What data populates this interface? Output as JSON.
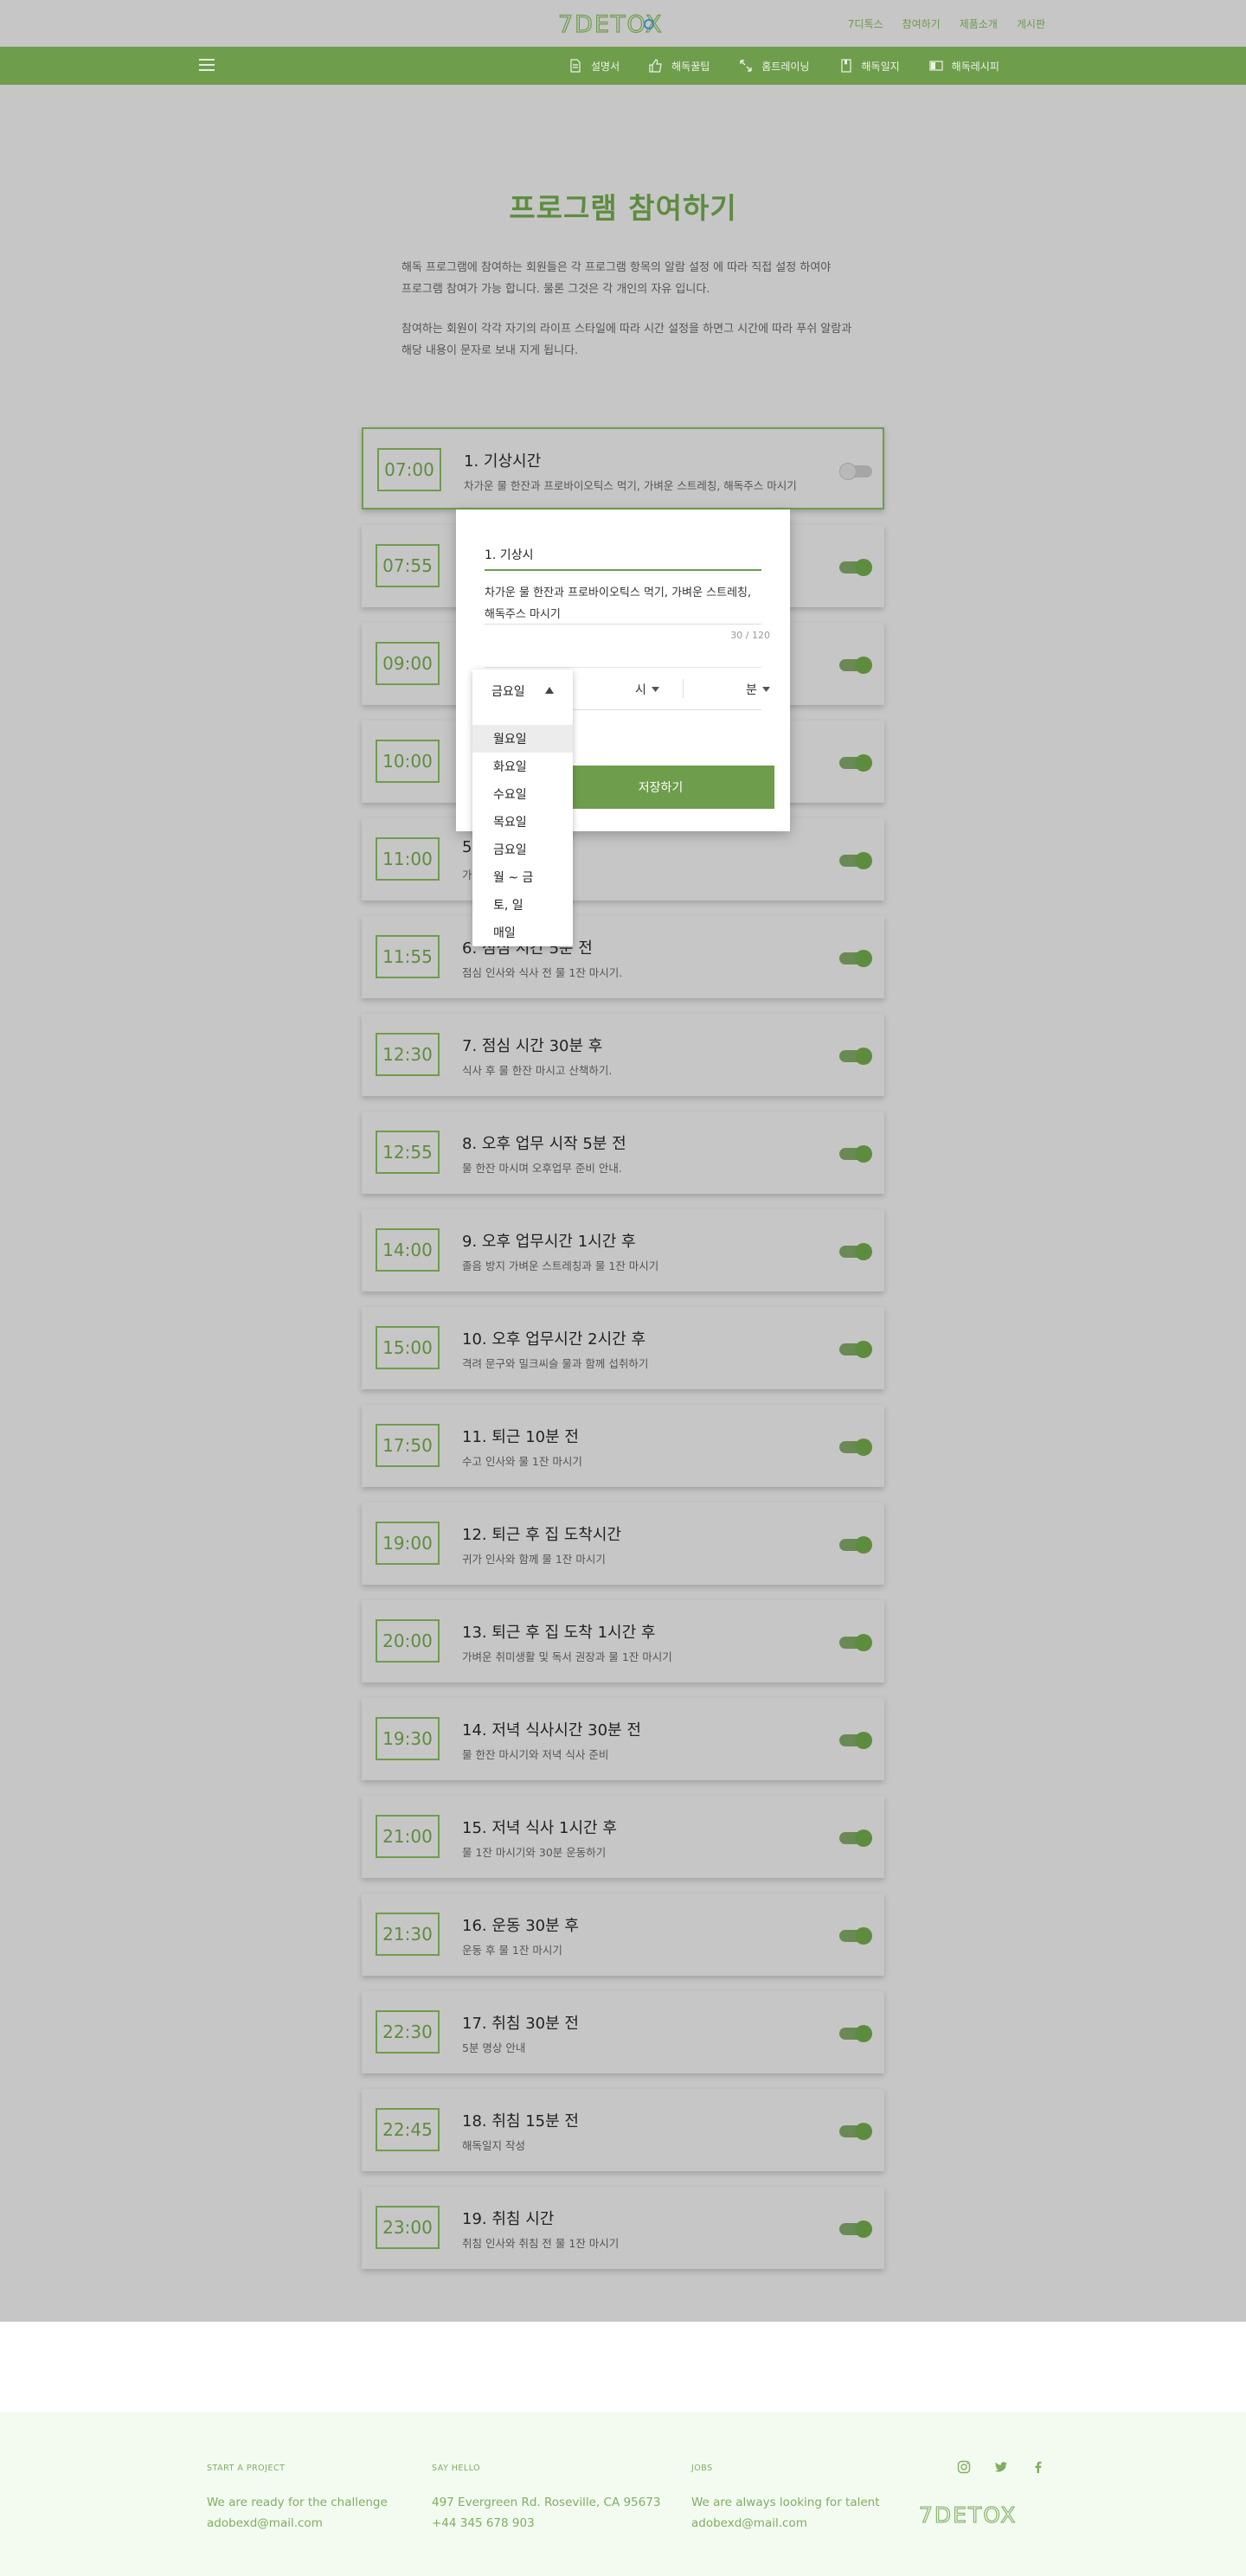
{
  "brand": {
    "logo_text": "7DETOX"
  },
  "top_links": [
    "7디톡스",
    "참여하기",
    "제품소개",
    "게시판"
  ],
  "nav": {
    "items": [
      {
        "label": "설명서",
        "icon": "document-icon"
      },
      {
        "label": "해독꿀팁",
        "icon": "thumbs-up-icon"
      },
      {
        "label": "홈트레이닝",
        "icon": "expand-arrows-icon"
      },
      {
        "label": "해독일지",
        "icon": "journal-icon"
      },
      {
        "label": "해독레시피",
        "icon": "recipe-icon"
      }
    ]
  },
  "page": {
    "title": "프로그램 참여하기",
    "intro_1a": "해독 프로그램에 참여하는 회원들은 각 프로그램 항목의 알람 설정 에 따라 직접 설정 하여야",
    "intro_1b": "프로그램 참여가 가능 합니다. 물론 그것은 각 개인의 자유 입니다.",
    "intro_2a": "참여하는 회원이 각각 자기의 라이프 스타일에 따라 시간 설정을 하면그 시간에 따라 푸쉬 알람과",
    "intro_2b": "해당 내용이 문자로 보내 지게 됩니다."
  },
  "schedule": [
    {
      "time": "07:00",
      "title": "1. 기상시간",
      "desc": "차가운 물 한잔과 프로바이오틱스 먹기, 가벼운 스트레칭, 해독주스 마시기",
      "enabled": false,
      "selected": true
    },
    {
      "time": "07:55",
      "title": "",
      "desc": "",
      "enabled": true
    },
    {
      "time": "09:00",
      "title": "",
      "desc": "",
      "enabled": true
    },
    {
      "time": "10:00",
      "title": "",
      "desc": "",
      "enabled": true
    },
    {
      "time": "11:00",
      "title": "5",
      "desc": "가 물 1잔 마시기.",
      "enabled": true
    },
    {
      "time": "11:55",
      "title": "6. 점심 시간 5분 전",
      "desc": "점심 인사와 식사 전 물 1잔 마시기.",
      "enabled": true
    },
    {
      "time": "12:30",
      "title": "7. 점심 시간 30분 후",
      "desc": "식사 후 물 한잔 마시고 산책하기.",
      "enabled": true
    },
    {
      "time": "12:55",
      "title": "8. 오후 업무 시작 5분 전",
      "desc": "물 한잔 마시며 오후업무 준비 안내.",
      "enabled": true
    },
    {
      "time": "14:00",
      "title": "9. 오후 업무시간 1시간 후",
      "desc": "졸음 방지 가벼운 스트레칭과 물 1잔 마시기",
      "enabled": true
    },
    {
      "time": "15:00",
      "title": "10. 오후 업무시간 2시간 후",
      "desc": "격려 문구와 밀크씨슬 물과 함께 섭취하기",
      "enabled": true
    },
    {
      "time": "17:50",
      "title": "11. 퇴근 10분 전",
      "desc": "수고 인사와 물 1잔 마시기",
      "enabled": true
    },
    {
      "time": "19:00",
      "title": "12. 퇴근 후 집 도착시간",
      "desc": "귀가 인사와 함께 물 1잔 마시기",
      "enabled": true
    },
    {
      "time": "20:00",
      "title": "13. 퇴근 후 집 도착 1시간 후",
      "desc": "가벼운 취미생활 및 독서 권장과 물 1잔 마시기",
      "enabled": true
    },
    {
      "time": "19:30",
      "title": "14. 저녁 식사시간 30분 전",
      "desc": "물 한잔 마시기와 저녁 식사 준비",
      "enabled": true
    },
    {
      "time": "21:00",
      "title": "15. 저녁 식사 1시간 후",
      "desc": "물 1잔 마시기와 30분 운동하기",
      "enabled": true
    },
    {
      "time": "21:30",
      "title": "16. 운동 30분 후",
      "desc": "운동 후 물 1잔 마시기",
      "enabled": true
    },
    {
      "time": "22:30",
      "title": "17. 취침 30분 전",
      "desc": "5분 명상 안내",
      "enabled": true
    },
    {
      "time": "22:45",
      "title": "18. 취침 15분 전",
      "desc": "해독일지 작성",
      "enabled": true
    },
    {
      "time": "23:00",
      "title": "19. 취침 시간",
      "desc": "취침 인사와 취침 전 물 1잔 마시기",
      "enabled": true
    }
  ],
  "modal": {
    "title_value": "1. 기상시",
    "desc_line1": "차가운 물 한잔과 프로바이오틱스 먹기, 가벼운 스트레칭,",
    "desc_line2": "해독주스 마시기",
    "char_count": "30 / 120",
    "hour_label": "시",
    "minute_label": "분",
    "save_label": "저장하기"
  },
  "day_dropdown": {
    "selected": "금요일",
    "options": [
      "월요일",
      "화요일",
      "수요일",
      "목요일",
      "금요일",
      "월 ~ 금",
      "토, 일",
      "매일"
    ]
  },
  "footer": {
    "col1": {
      "heading": "START A PROJECT",
      "line1": "We are ready for the challenge",
      "line2": "adobexd@mail.com"
    },
    "col2": {
      "heading": "SAY HELLO",
      "line1": "497 Evergreen Rd. Roseville, CA 95673",
      "line2": "+44 345 678 903"
    },
    "col3": {
      "heading": "JOBS",
      "line1": "We are always looking for talent",
      "line2": "adobexd@mail.com"
    },
    "social": [
      "instagram-icon",
      "twitter-icon",
      "facebook-icon"
    ]
  },
  "colors": {
    "accent": "#6e9d4c",
    "overlay_bg": "#c6c6c6",
    "footer_bg": "#f3fbf0"
  }
}
